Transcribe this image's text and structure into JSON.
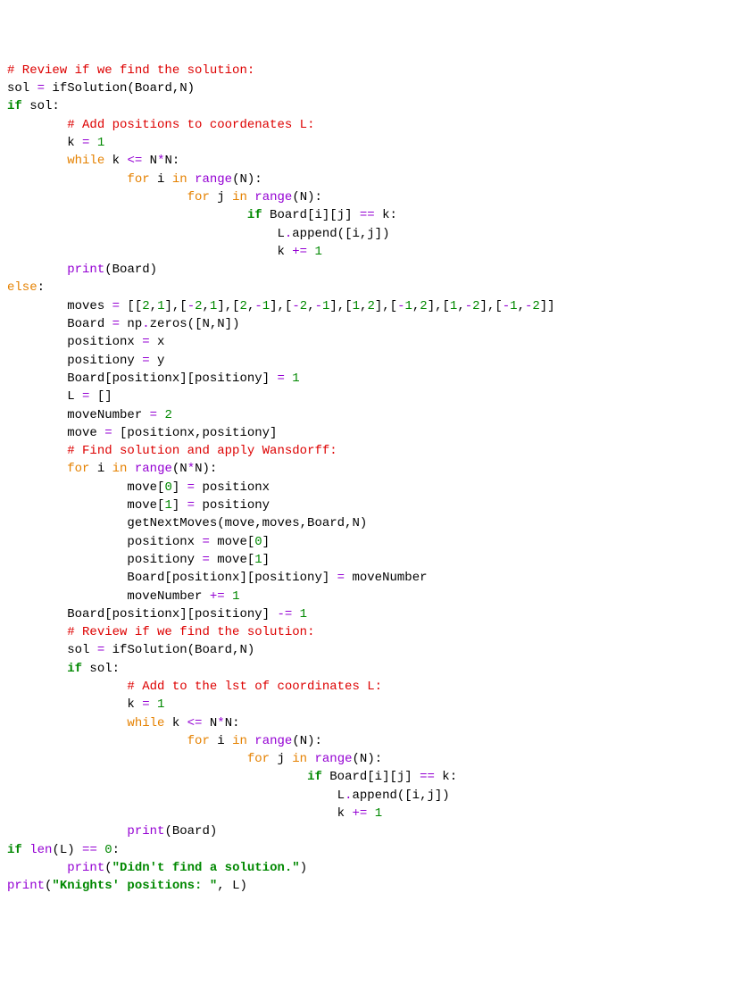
{
  "lines": [
    [
      [
        "cm",
        "# Review if we find the solution:"
      ]
    ],
    [
      [
        "nm",
        "sol "
      ],
      [
        "pk",
        "="
      ],
      [
        "nm",
        " ifSolution(Board,N)"
      ]
    ],
    [
      [
        "kw",
        "if"
      ],
      [
        "nm",
        " sol:"
      ]
    ],
    [
      [
        "nm",
        "        "
      ],
      [
        "cm",
        "# Add positions to coordenates L:"
      ]
    ],
    [
      [
        "nm",
        "        k "
      ],
      [
        "pk",
        "="
      ],
      [
        "nm",
        " "
      ],
      [
        "num",
        "1"
      ]
    ],
    [
      [
        "nm",
        "        "
      ],
      [
        "kwc",
        "while"
      ],
      [
        "nm",
        " k "
      ],
      [
        "pk",
        "<="
      ],
      [
        "nm",
        " N"
      ],
      [
        "pk",
        "*"
      ],
      [
        "nm",
        "N:"
      ]
    ],
    [
      [
        "nm",
        "                "
      ],
      [
        "kwc",
        "for"
      ],
      [
        "nm",
        " i "
      ],
      [
        "kwc",
        "in"
      ],
      [
        "nm",
        " "
      ],
      [
        "pk",
        "range"
      ],
      [
        "nm",
        "(N):"
      ]
    ],
    [
      [
        "nm",
        "                        "
      ],
      [
        "kwc",
        "for"
      ],
      [
        "nm",
        " j "
      ],
      [
        "kwc",
        "in"
      ],
      [
        "nm",
        " "
      ],
      [
        "pk",
        "range"
      ],
      [
        "nm",
        "(N):"
      ]
    ],
    [
      [
        "nm",
        "                                "
      ],
      [
        "kw",
        "if"
      ],
      [
        "nm",
        " Board[i][j] "
      ],
      [
        "pk",
        "=="
      ],
      [
        "nm",
        " k:"
      ]
    ],
    [
      [
        "nm",
        "                                    L"
      ],
      [
        "pk",
        "."
      ],
      [
        "nm",
        "append([i,j])"
      ]
    ],
    [
      [
        "nm",
        "                                    k "
      ],
      [
        "pk",
        "+="
      ],
      [
        "nm",
        " "
      ],
      [
        "num",
        "1"
      ]
    ],
    [
      [
        "nm",
        "        "
      ],
      [
        "pk",
        "print"
      ],
      [
        "nm",
        "(Board)"
      ]
    ],
    [
      [
        "kwc",
        "else"
      ],
      [
        "nm",
        ":"
      ]
    ],
    [
      [
        "nm",
        "        moves "
      ],
      [
        "pk",
        "="
      ],
      [
        "nm",
        " [["
      ],
      [
        "num",
        "2"
      ],
      [
        "nm",
        ","
      ],
      [
        "num",
        "1"
      ],
      [
        "nm",
        "],["
      ],
      [
        "pk",
        "-"
      ],
      [
        "num",
        "2"
      ],
      [
        "nm",
        ","
      ],
      [
        "num",
        "1"
      ],
      [
        "nm",
        "],["
      ],
      [
        "num",
        "2"
      ],
      [
        "nm",
        ","
      ],
      [
        "pk",
        "-"
      ],
      [
        "num",
        "1"
      ],
      [
        "nm",
        "],["
      ],
      [
        "pk",
        "-"
      ],
      [
        "num",
        "2"
      ],
      [
        "nm",
        ","
      ],
      [
        "pk",
        "-"
      ],
      [
        "num",
        "1"
      ],
      [
        "nm",
        "],["
      ],
      [
        "num",
        "1"
      ],
      [
        "nm",
        ","
      ],
      [
        "num",
        "2"
      ],
      [
        "nm",
        "],["
      ],
      [
        "pk",
        "-"
      ],
      [
        "num",
        "1"
      ],
      [
        "nm",
        ","
      ],
      [
        "num",
        "2"
      ],
      [
        "nm",
        "],["
      ],
      [
        "num",
        "1"
      ],
      [
        "nm",
        ","
      ],
      [
        "pk",
        "-"
      ],
      [
        "num",
        "2"
      ],
      [
        "nm",
        "],["
      ],
      [
        "pk",
        "-"
      ],
      [
        "num",
        "1"
      ],
      [
        "nm",
        ","
      ],
      [
        "pk",
        "-"
      ],
      [
        "num",
        "2"
      ],
      [
        "nm",
        "]]"
      ]
    ],
    [
      [
        "nm",
        "        Board "
      ],
      [
        "pk",
        "="
      ],
      [
        "nm",
        " np"
      ],
      [
        "pk",
        "."
      ],
      [
        "nm",
        "zeros([N,N])"
      ]
    ],
    [
      [
        "nm",
        "        positionx "
      ],
      [
        "pk",
        "="
      ],
      [
        "nm",
        " x"
      ]
    ],
    [
      [
        "nm",
        "        positiony "
      ],
      [
        "pk",
        "="
      ],
      [
        "nm",
        " y"
      ]
    ],
    [
      [
        "nm",
        "        Board[positionx][positiony] "
      ],
      [
        "pk",
        "="
      ],
      [
        "nm",
        " "
      ],
      [
        "num",
        "1"
      ]
    ],
    [
      [
        "nm",
        "        L "
      ],
      [
        "pk",
        "="
      ],
      [
        "nm",
        " []"
      ]
    ],
    [
      [
        "nm",
        "        moveNumber "
      ],
      [
        "pk",
        "="
      ],
      [
        "nm",
        " "
      ],
      [
        "num",
        "2"
      ]
    ],
    [
      [
        "nm",
        "        move "
      ],
      [
        "pk",
        "="
      ],
      [
        "nm",
        " [positionx,positiony]"
      ]
    ],
    [
      [
        "nm",
        "        "
      ],
      [
        "cm",
        "# Find solution and apply Wansdorff:"
      ]
    ],
    [
      [
        "nm",
        "        "
      ],
      [
        "kwc",
        "for"
      ],
      [
        "nm",
        " i "
      ],
      [
        "kwc",
        "in"
      ],
      [
        "nm",
        " "
      ],
      [
        "pk",
        "range"
      ],
      [
        "nm",
        "(N"
      ],
      [
        "pk",
        "*"
      ],
      [
        "nm",
        "N):"
      ]
    ],
    [
      [
        "nm",
        "                move["
      ],
      [
        "num",
        "0"
      ],
      [
        "nm",
        "] "
      ],
      [
        "pk",
        "="
      ],
      [
        "nm",
        " positionx"
      ]
    ],
    [
      [
        "nm",
        "                move["
      ],
      [
        "num",
        "1"
      ],
      [
        "nm",
        "] "
      ],
      [
        "pk",
        "="
      ],
      [
        "nm",
        " positiony"
      ]
    ],
    [
      [
        "nm",
        "                getNextMoves(move,moves,Board,N)"
      ]
    ],
    [
      [
        "nm",
        "                positionx "
      ],
      [
        "pk",
        "="
      ],
      [
        "nm",
        " move["
      ],
      [
        "num",
        "0"
      ],
      [
        "nm",
        "]"
      ]
    ],
    [
      [
        "nm",
        "                positiony "
      ],
      [
        "pk",
        "="
      ],
      [
        "nm",
        " move["
      ],
      [
        "num",
        "1"
      ],
      [
        "nm",
        "]"
      ]
    ],
    [
      [
        "nm",
        "                Board[positionx][positiony] "
      ],
      [
        "pk",
        "="
      ],
      [
        "nm",
        " moveNumber"
      ]
    ],
    [
      [
        "nm",
        "                moveNumber "
      ],
      [
        "pk",
        "+="
      ],
      [
        "nm",
        " "
      ],
      [
        "num",
        "1"
      ]
    ],
    [
      [
        "nm",
        "        Board[positionx][positiony] "
      ],
      [
        "pk",
        "-="
      ],
      [
        "nm",
        " "
      ],
      [
        "num",
        "1"
      ]
    ],
    [
      [
        "nm",
        ""
      ]
    ],
    [
      [
        "nm",
        "        "
      ],
      [
        "cm",
        "# Review if we find the solution:"
      ]
    ],
    [
      [
        "nm",
        "        sol "
      ],
      [
        "pk",
        "="
      ],
      [
        "nm",
        " ifSolution(Board,N)"
      ]
    ],
    [
      [
        "nm",
        "        "
      ],
      [
        "kw",
        "if"
      ],
      [
        "nm",
        " sol:"
      ]
    ],
    [
      [
        "nm",
        "                "
      ],
      [
        "cm",
        "# Add to the lst of coordinates L:"
      ]
    ],
    [
      [
        "nm",
        "                k "
      ],
      [
        "pk",
        "="
      ],
      [
        "nm",
        " "
      ],
      [
        "num",
        "1"
      ]
    ],
    [
      [
        "nm",
        "                "
      ],
      [
        "kwc",
        "while"
      ],
      [
        "nm",
        " k "
      ],
      [
        "pk",
        "<="
      ],
      [
        "nm",
        " N"
      ],
      [
        "pk",
        "*"
      ],
      [
        "nm",
        "N:"
      ]
    ],
    [
      [
        "nm",
        "                        "
      ],
      [
        "kwc",
        "for"
      ],
      [
        "nm",
        " i "
      ],
      [
        "kwc",
        "in"
      ],
      [
        "nm",
        " "
      ],
      [
        "pk",
        "range"
      ],
      [
        "nm",
        "(N):"
      ]
    ],
    [
      [
        "nm",
        "                                "
      ],
      [
        "kwc",
        "for"
      ],
      [
        "nm",
        " j "
      ],
      [
        "kwc",
        "in"
      ],
      [
        "nm",
        " "
      ],
      [
        "pk",
        "range"
      ],
      [
        "nm",
        "(N):"
      ]
    ],
    [
      [
        "nm",
        "                                        "
      ],
      [
        "kw",
        "if"
      ],
      [
        "nm",
        " Board[i][j] "
      ],
      [
        "pk",
        "=="
      ],
      [
        "nm",
        " k:"
      ]
    ],
    [
      [
        "nm",
        "                                            L"
      ],
      [
        "pk",
        "."
      ],
      [
        "nm",
        "append([i,j])"
      ]
    ],
    [
      [
        "nm",
        "                                            k "
      ],
      [
        "pk",
        "+="
      ],
      [
        "nm",
        " "
      ],
      [
        "num",
        "1"
      ]
    ],
    [
      [
        "nm",
        "                "
      ],
      [
        "pk",
        "print"
      ],
      [
        "nm",
        "(Board)"
      ]
    ],
    [
      [
        "kw",
        "if"
      ],
      [
        "nm",
        " "
      ],
      [
        "pk",
        "len"
      ],
      [
        "nm",
        "(L) "
      ],
      [
        "pk",
        "=="
      ],
      [
        "nm",
        " "
      ],
      [
        "num",
        "0"
      ],
      [
        "nm",
        ":"
      ]
    ],
    [
      [
        "nm",
        "        "
      ],
      [
        "pk",
        "print"
      ],
      [
        "nm",
        "("
      ],
      [
        "kw",
        "\"Didn't find a solution.\""
      ],
      [
        "nm",
        ")"
      ]
    ],
    [
      [
        "pk",
        "print"
      ],
      [
        "nm",
        "("
      ],
      [
        "kw",
        "\"Knights' positions: \""
      ],
      [
        "nm",
        ", L)"
      ]
    ]
  ],
  "colors": {
    "comment": "#dd0000",
    "keyword_green": "#008800",
    "keyword_orange": "#e58100",
    "purple": "#9400d3",
    "string_green": "#008800"
  }
}
